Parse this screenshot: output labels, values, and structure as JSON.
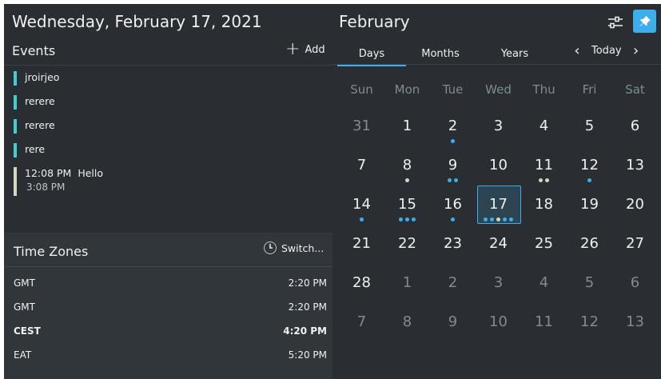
{
  "header": {
    "date_title": "Wednesday, February 17, 2021",
    "month_title": "February"
  },
  "events": {
    "heading": "Events",
    "add_label": "Add",
    "items": [
      {
        "title": "jroirjeo",
        "color": "#3ecfd3"
      },
      {
        "title": "rerere",
        "color": "#3ecfd3"
      },
      {
        "title": "rerere",
        "color": "#3ecfd3"
      },
      {
        "title": "rere",
        "color": "#3ecfd3"
      },
      {
        "time": "12:08 PM",
        "title": "Hello",
        "end": "3:08 PM",
        "color": "#d5d7b8"
      }
    ]
  },
  "timezones": {
    "heading": "Time Zones",
    "switch_label": "Switch...",
    "rows": [
      {
        "zone": "GMT",
        "time": "2:20 PM"
      },
      {
        "zone": "GMT",
        "time": "2:20 PM"
      },
      {
        "zone": "CEST",
        "time": "4:20 PM",
        "bold": true
      },
      {
        "zone": "EAT",
        "time": "5:20 PM"
      }
    ]
  },
  "calendar": {
    "tabs": [
      "Days",
      "Months",
      "Years"
    ],
    "active_tab": "Days",
    "today_label": "Today",
    "weekdays": [
      "Sun",
      "Mon",
      "Tue",
      "Wed",
      "Thu",
      "Fri",
      "Sat"
    ],
    "weeks": [
      [
        {
          "d": "31",
          "o": true
        },
        {
          "d": "1"
        },
        {
          "d": "2",
          "dots": [
            "b"
          ]
        },
        {
          "d": "3"
        },
        {
          "d": "4"
        },
        {
          "d": "5"
        },
        {
          "d": "6"
        }
      ],
      [
        {
          "d": "7"
        },
        {
          "d": "8",
          "dots": [
            "y"
          ]
        },
        {
          "d": "9",
          "dots": [
            "b",
            "b"
          ]
        },
        {
          "d": "10"
        },
        {
          "d": "11",
          "dots": [
            "y",
            "y"
          ]
        },
        {
          "d": "12",
          "dots": [
            "b"
          ]
        },
        {
          "d": "13"
        }
      ],
      [
        {
          "d": "14",
          "dots": [
            "b"
          ]
        },
        {
          "d": "15",
          "dots": [
            "b",
            "b",
            "b"
          ]
        },
        {
          "d": "16",
          "dots": [
            "b"
          ]
        },
        {
          "d": "17",
          "sel": true,
          "dots": [
            "b",
            "b",
            "y",
            "b",
            "b"
          ]
        },
        {
          "d": "18"
        },
        {
          "d": "19"
        },
        {
          "d": "20"
        }
      ],
      [
        {
          "d": "21"
        },
        {
          "d": "22"
        },
        {
          "d": "23"
        },
        {
          "d": "24"
        },
        {
          "d": "25"
        },
        {
          "d": "26"
        },
        {
          "d": "27"
        }
      ],
      [
        {
          "d": "28"
        },
        {
          "d": "1",
          "o": true
        },
        {
          "d": "2",
          "o": true
        },
        {
          "d": "3",
          "o": true
        },
        {
          "d": "4",
          "o": true
        },
        {
          "d": "5",
          "o": true
        },
        {
          "d": "6",
          "o": true
        }
      ],
      [
        {
          "d": "7",
          "o": true
        },
        {
          "d": "8",
          "o": true
        },
        {
          "d": "9",
          "o": true
        },
        {
          "d": "10",
          "o": true
        },
        {
          "d": "11",
          "o": true
        },
        {
          "d": "12",
          "o": true
        },
        {
          "d": "13",
          "o": true
        }
      ]
    ]
  },
  "colors": {
    "accent": "#3daee9",
    "event_cyan": "#3ecfd3",
    "event_yellow": "#d5d7b8",
    "background": "#2a2e32"
  },
  "icons": {
    "add": "plus-icon",
    "switch": "clock-icon",
    "config": "sliders-icon",
    "pin": "pin-icon",
    "prev": "chevron-left-icon",
    "next": "chevron-right-icon"
  }
}
